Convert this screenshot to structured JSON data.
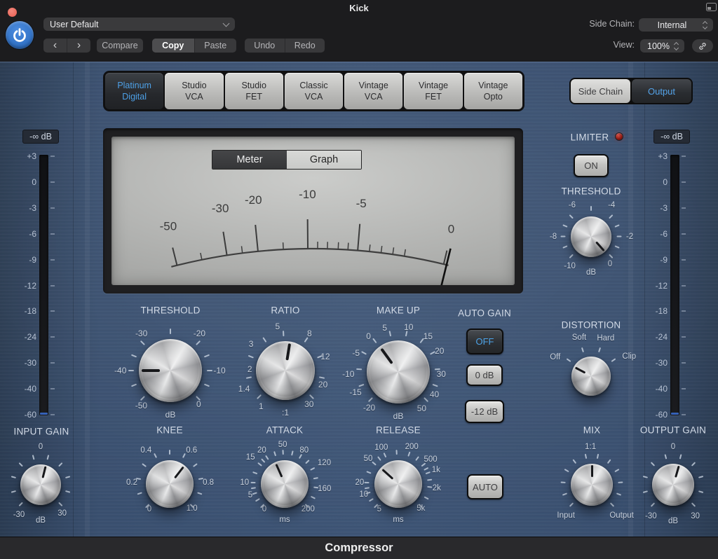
{
  "window": {
    "title": "Kick",
    "plugin_name": "Compressor"
  },
  "colors": {
    "accent_blue": "#4da3e8",
    "led_red": "#8e1912",
    "panel_blue": "#3e5576"
  },
  "header": {
    "preset_value": "User Default",
    "back": "‹",
    "forward": "›",
    "compare": "Compare",
    "copy": "Copy",
    "paste": "Paste",
    "undo": "Undo",
    "redo": "Redo",
    "side_chain_label": "Side Chain:",
    "side_chain_value": "Internal",
    "view_label": "View:",
    "view_value": "100%"
  },
  "models": {
    "selected": 0,
    "items": [
      {
        "label1": "Platinum",
        "label2": "Digital"
      },
      {
        "label1": "Studio",
        "label2": "VCA"
      },
      {
        "label1": "Studio",
        "label2": "FET"
      },
      {
        "label1": "Classic",
        "label2": "VCA"
      },
      {
        "label1": "Vintage",
        "label2": "VCA"
      },
      {
        "label1": "Vintage",
        "label2": "FET"
      },
      {
        "label1": "Vintage",
        "label2": "Opto"
      }
    ]
  },
  "io_tabs": {
    "side_chain": "Side Chain",
    "output": "Output",
    "selected": "Output"
  },
  "display": {
    "tabs": {
      "meter": "Meter",
      "graph": "Graph",
      "selected": "Meter"
    },
    "majors": [
      {
        "t": "-50",
        "a": -14
      },
      {
        "t": "-30",
        "a": -8.8
      },
      {
        "t": "-20",
        "a": -5.6
      },
      {
        "t": "-10",
        "a": -0.5
      },
      {
        "t": "-5",
        "a": 4.6
      },
      {
        "t": "0",
        "a": 13.5
      }
    ],
    "minors": [
      -11.4,
      -7.2,
      -3,
      0.5,
      1.5,
      2.6,
      3.6,
      5.8,
      7,
      8.2,
      9.4
    ],
    "needle_a": 13.8
  },
  "meters": {
    "input": {
      "readout": "-∞ dB",
      "scale": [
        "+3",
        "0",
        "-3",
        "-6",
        "-9",
        "-12",
        "-18",
        "-24",
        "-30",
        "-40",
        "-60"
      ]
    },
    "output": {
      "readout": "-∞ dB",
      "scale": [
        "+3",
        "0",
        "-3",
        "-6",
        "-9",
        "-12",
        "-18",
        "-24",
        "-30",
        "-40",
        "-60"
      ]
    }
  },
  "knobs": {
    "input_gain": {
      "title": "INPUT GAIN",
      "unit": "dB",
      "ind": 14,
      "labels": [
        {
          "t": "0",
          "a": 0,
          "r": 1.12
        },
        {
          "t": "-30",
          "a": -144,
          "r": 1.1
        },
        {
          "t": "30",
          "a": 143,
          "r": 1.06
        }
      ],
      "ticks": [
        -135,
        -105,
        -75,
        -45,
        -15,
        15,
        45,
        75,
        105,
        135
      ]
    },
    "threshold": {
      "title": "THRESHOLD",
      "unit": "dB",
      "ind": -90,
      "labels": [
        {
          "t": "-50",
          "a": -140,
          "r": 0.98
        },
        {
          "t": "-40",
          "a": -90,
          "r": 1.08
        },
        {
          "t": "-30",
          "a": -38,
          "r": 1.02
        },
        {
          "t": "-20",
          "a": 38,
          "r": 1.02
        },
        {
          "t": "-10",
          "a": 90,
          "r": 1.06
        },
        {
          "t": "0",
          "a": 140,
          "r": 0.95
        }
      ],
      "ticks": [
        -135,
        -112,
        -90,
        -68,
        -45,
        0,
        45,
        68,
        90,
        112,
        135
      ]
    },
    "ratio": {
      "title": "RATIO",
      "unit": ":1",
      "ind": 9,
      "labels": [
        {
          "t": "1",
          "a": -146
        },
        {
          "t": "1.4",
          "a": -114,
          "r": 1.04
        },
        {
          "t": "2",
          "a": -88,
          "r": 0.82
        },
        {
          "t": "3",
          "a": -52
        },
        {
          "t": "5",
          "a": -10,
          "r": 1.04
        },
        {
          "t": "8",
          "a": 33,
          "r": 1.02
        },
        {
          "t": "12",
          "a": 71,
          "r": 0.97
        },
        {
          "t": "20",
          "a": 110,
          "r": 0.92
        },
        {
          "t": "30",
          "a": 145,
          "r": 0.95
        }
      ],
      "ticks": [
        -135,
        -101,
        -68,
        -34,
        -3,
        34,
        68,
        101,
        135
      ]
    },
    "makeup": {
      "title": "MAKE UP",
      "unit": "dB",
      "ind": -36,
      "labels": [
        {
          "t": "-20",
          "a": -141
        },
        {
          "t": "-15",
          "a": -115,
          "r": 1.02
        },
        {
          "t": "-10",
          "a": -92,
          "r": 1.08
        },
        {
          "t": "-5",
          "a": -66
        },
        {
          "t": "0",
          "a": -40
        },
        {
          "t": "5",
          "a": -17
        },
        {
          "t": "10",
          "a": 13
        },
        {
          "t": "15",
          "a": 40
        },
        {
          "t": "20",
          "a": 63
        },
        {
          "t": "30",
          "a": 93,
          "r": 0.93
        },
        {
          "t": "40",
          "a": 122,
          "r": 0.92
        },
        {
          "t": "50",
          "a": 147,
          "r": 0.93
        }
      ],
      "ticks": [
        -135,
        -110,
        -86,
        -61,
        -37,
        -12,
        12,
        37,
        61,
        86,
        110,
        135
      ]
    },
    "knee": {
      "title": "KNEE",
      "ind": 38,
      "labels": [
        {
          "t": "0",
          "a": -141,
          "r": 0.89
        },
        {
          "t": "0.2",
          "a": -88,
          "r": 1.04
        },
        {
          "t": "0.4",
          "a": -35,
          "r": 1.13
        },
        {
          "t": "0.6",
          "a": 33,
          "r": 1.1
        },
        {
          "t": "0.8",
          "a": 88,
          "r": 1.06
        },
        {
          "t": "1.0",
          "a": 138,
          "r": 0.91
        }
      ],
      "ticks": [
        -135,
        -108,
        -81,
        -54,
        -27,
        0,
        27,
        54,
        81,
        108,
        135
      ]
    },
    "attack": {
      "title": "ATTACK",
      "unit": "ms",
      "ind": -24,
      "labels": [
        {
          "t": "0",
          "a": -141,
          "r": 0.89
        },
        {
          "t": "5",
          "a": -108,
          "r": 0.99
        },
        {
          "t": "10",
          "a": -88,
          "r": 1.1
        },
        {
          "t": "15",
          "a": -52,
          "r": 1.19
        },
        {
          "t": "20",
          "a": -34,
          "r": 1.12
        },
        {
          "t": "50",
          "a": -3,
          "r": 1.08
        },
        {
          "t": "80",
          "a": 30,
          "r": 1.07
        },
        {
          "t": "120",
          "a": 62,
          "r": 1.23
        },
        {
          "t": "160",
          "a": 97,
          "r": 1.1
        },
        {
          "t": "200",
          "a": 137,
          "r": 0.94
        }
      ],
      "ticks": [
        -135,
        -121,
        -108,
        -98,
        -88,
        -70,
        -52,
        -43,
        -34,
        -18,
        -3,
        14,
        30,
        46,
        62,
        80,
        97,
        116,
        135
      ]
    },
    "release": {
      "title": "RELEASE",
      "unit": "ms",
      "ind": -48,
      "labels": [
        {
          "t": "5",
          "a": -143,
          "r": 0.87
        },
        {
          "t": "10",
          "a": -107,
          "r": 0.99
        },
        {
          "t": "20",
          "a": -88,
          "r": 1.06
        },
        {
          "t": "50",
          "a": -50,
          "r": 1.08
        },
        {
          "t": "100",
          "a": -25,
          "r": 1.1
        },
        {
          "t": "200",
          "a": 20,
          "r": 1.08
        },
        {
          "t": "500",
          "a": 53,
          "r": 1.11
        },
        {
          "t": "1k",
          "a": 70,
          "r": 1.1
        },
        {
          "t": "2k",
          "a": 96,
          "r": 1.06
        },
        {
          "t": "5k",
          "a": 137,
          "r": 0.91
        }
      ],
      "ticks": [
        -135,
        -121,
        -107,
        -98,
        -88,
        -69,
        -50,
        -37,
        -25,
        -3,
        20,
        37,
        53,
        62,
        70,
        83,
        96,
        117,
        135
      ]
    },
    "limiter_threshold": {
      "title": "THRESHOLD",
      "unit": "dB",
      "ind": 138,
      "labels": [
        {
          "t": "-10",
          "a": -144,
          "r": 1.1
        },
        {
          "t": "-8",
          "a": -90,
          "r": 1.15
        },
        {
          "t": "-6",
          "a": -31,
          "r": 1.12
        },
        {
          "t": "-4",
          "a": 33,
          "r": 1.14
        },
        {
          "t": "-2",
          "a": 90,
          "r": 1.17
        },
        {
          "t": "0",
          "a": 145
        }
      ],
      "ticks": [
        -135,
        -112,
        -90,
        -68,
        -45,
        0,
        45,
        68,
        90,
        112,
        135
      ]
    },
    "distortion": {
      "title": "DISTORTION",
      "ind": -62,
      "labels": [
        {
          "t": "Off",
          "a": -62
        },
        {
          "t": "Soft",
          "a": -17
        },
        {
          "t": "Hard",
          "a": 21
        },
        {
          "t": "Clip",
          "a": 63,
          "r": 1.05
        }
      ],
      "ticks": [
        -55,
        -18,
        18,
        55
      ]
    },
    "mix": {
      "title": "MIX",
      "ind": 0,
      "labels": [
        {
          "t": "1:1",
          "a": -2,
          "r": 1.04
        },
        {
          "t": "Input",
          "a": -140,
          "r": 1.1
        },
        {
          "t": "Output",
          "a": 136,
          "r": 1.18
        }
      ],
      "ticks": [
        -135,
        -110,
        -86,
        -61,
        -37,
        -12,
        12,
        37,
        61,
        86,
        110,
        135
      ]
    },
    "output_gain": {
      "title": "OUTPUT GAIN",
      "unit": "dB",
      "ind": 16,
      "labels": [
        {
          "t": "0",
          "a": 0,
          "r": 1.12
        },
        {
          "t": "-30",
          "a": -145,
          "r": 1.15
        },
        {
          "t": "30",
          "a": 145,
          "r": 1.15
        }
      ],
      "ticks": [
        -135,
        -105,
        -75,
        -45,
        -15,
        15,
        45,
        75,
        105,
        135
      ]
    }
  },
  "auto_gain": {
    "label": "AUTO GAIN",
    "options": [
      "OFF",
      "0 dB",
      "-12 dB"
    ],
    "selected": "OFF"
  },
  "auto_release": {
    "label": "AUTO"
  },
  "limiter": {
    "label": "LIMITER",
    "on_label": "ON"
  }
}
